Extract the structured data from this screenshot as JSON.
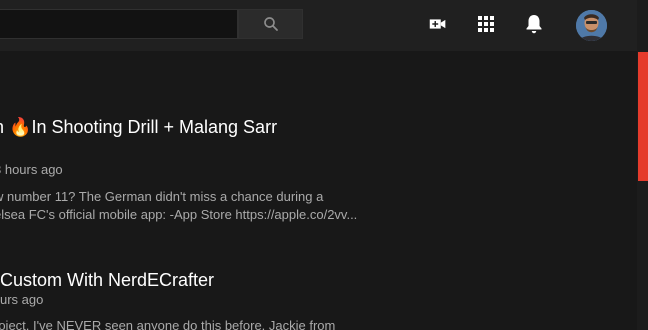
{
  "header": {
    "search": {
      "value": "",
      "placeholder": ""
    },
    "icons": {
      "search": "search-icon",
      "create": "video-camera-add-icon",
      "apps": "apps-grid-icon",
      "notifications": "bell-icon",
      "avatar": "avatar"
    }
  },
  "results": [
    {
      "title_prefix": "n ",
      "title_emoji": "🔥",
      "title_text": "In Shooting Drill + Malang Sarr",
      "meta": "3 hours ago",
      "desc_lines": [
        "w number 11? The German didn't miss a chance during a",
        "elsea FC's official mobile app: -App Store https://apple.co/2vv..."
      ]
    },
    {
      "title_text": "Custom With NerdECrafter",
      "meta": "urs ago",
      "desc_lines": [
        "roject, I've NEVER seen anyone do this before. Jackie from"
      ]
    }
  ],
  "colors": {
    "background": "#181818",
    "masthead": "#202020",
    "scroll_thumb": "#e53b2c"
  }
}
